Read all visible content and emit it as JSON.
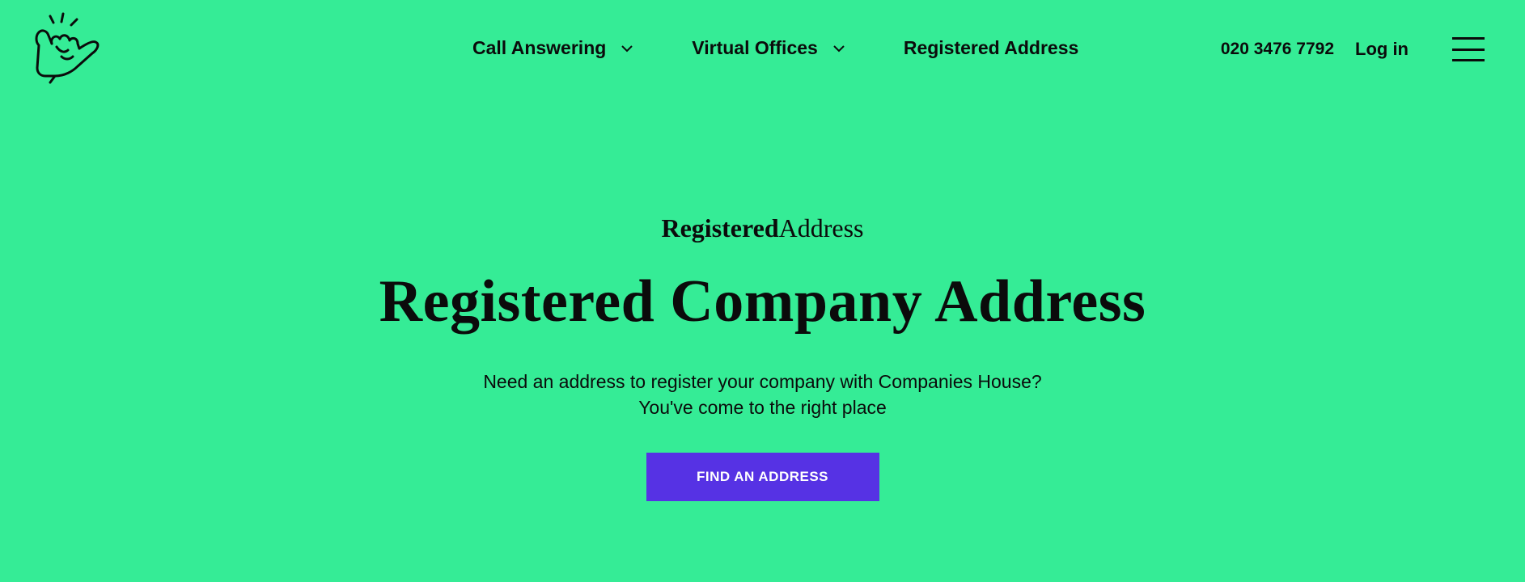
{
  "header": {
    "logo_icon": "shaka-hand-icon",
    "nav": [
      {
        "label": "Call Answering",
        "has_dropdown": true
      },
      {
        "label": "Virtual Offices",
        "has_dropdown": true
      },
      {
        "label": "Registered Address",
        "has_dropdown": false
      }
    ],
    "phone": "020 3476 7792",
    "login": "Log in",
    "menu_icon": "hamburger-icon"
  },
  "hero": {
    "brand_bold": "Registered",
    "brand_light": "Address",
    "title": "Registered Company Address",
    "subtitle_line1": "Need an address to register your company with Companies House?",
    "subtitle_line2": "You've come to the right place",
    "cta": "FIND AN ADDRESS"
  },
  "colors": {
    "background": "#35ec96",
    "cta_background": "#5632e4",
    "cta_text": "#ffffff",
    "text": "#0b0b0b"
  }
}
